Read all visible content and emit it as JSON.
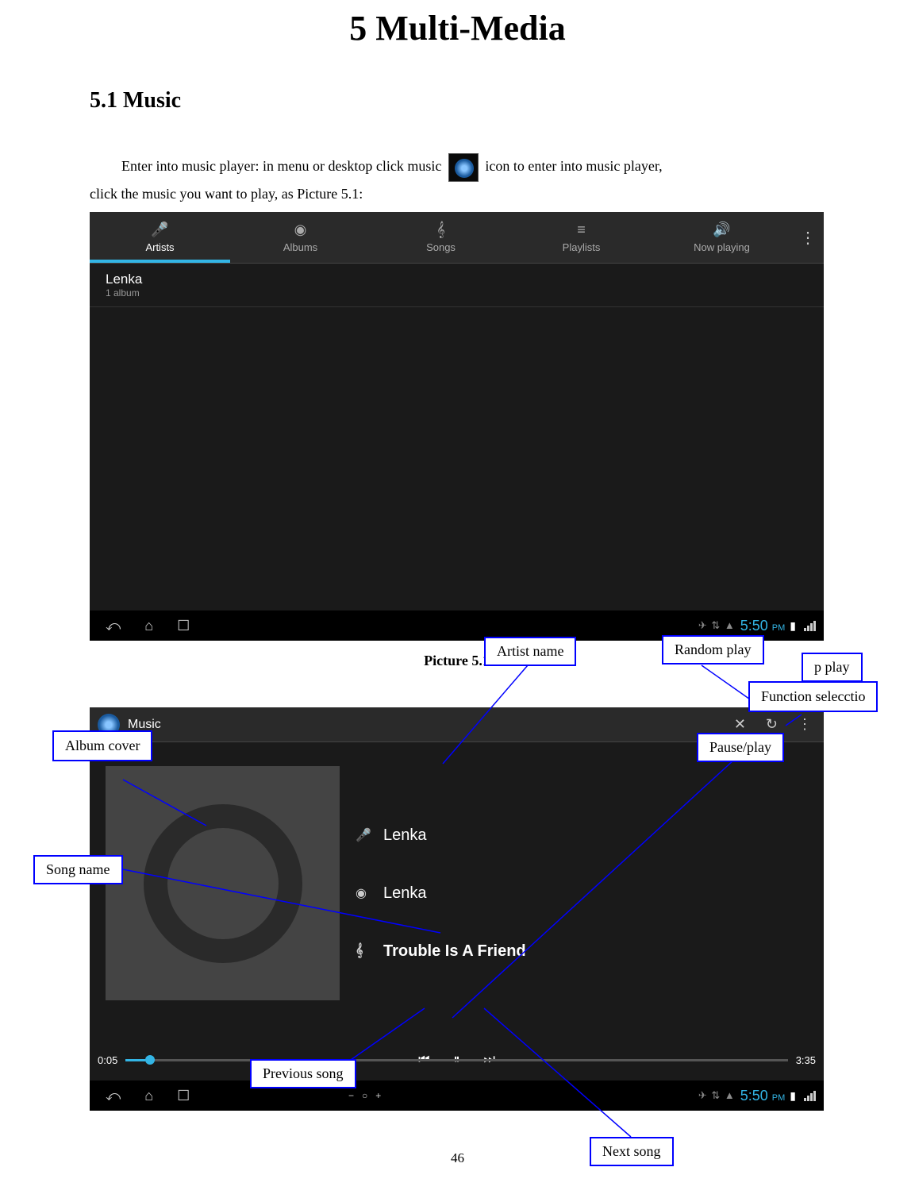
{
  "chapter_title": "5 Multi-Media",
  "section_title": "5.1 Music",
  "intro_line1_a": "Enter into music player: in menu or desktop click music ",
  "intro_line1_b": " icon to enter into music player,",
  "intro_line2": "click the music you want to play, as Picture 5.1:",
  "screenshot1": {
    "tabs": {
      "artists": "Artists",
      "albums": "Albums",
      "songs": "Songs",
      "playlists": "Playlists",
      "now_playing": "Now playing"
    },
    "artist_name": "Lenka",
    "album_count": "1 album",
    "time": "5:50",
    "time_pm": "PM"
  },
  "picture_caption_1": "Picture 5.1",
  "screenshot2": {
    "app_title": "Music",
    "artist": "Lenka",
    "album": "Lenka",
    "song": "Trouble Is A Friend",
    "time_elapsed": "0:05",
    "time_total": "3:35",
    "nav_time": "5:50",
    "nav_time_pm": "PM"
  },
  "callouts": {
    "artist_name": "Artist name",
    "random_play": "Random play",
    "loop_play": "p play",
    "function_selection": "Function selecctio",
    "pause_play": "Pause/play",
    "album_cover": "Album cover",
    "song_name": "Song name",
    "previous_song": "Previous song",
    "next_song": "Next song"
  },
  "page_number": "46"
}
